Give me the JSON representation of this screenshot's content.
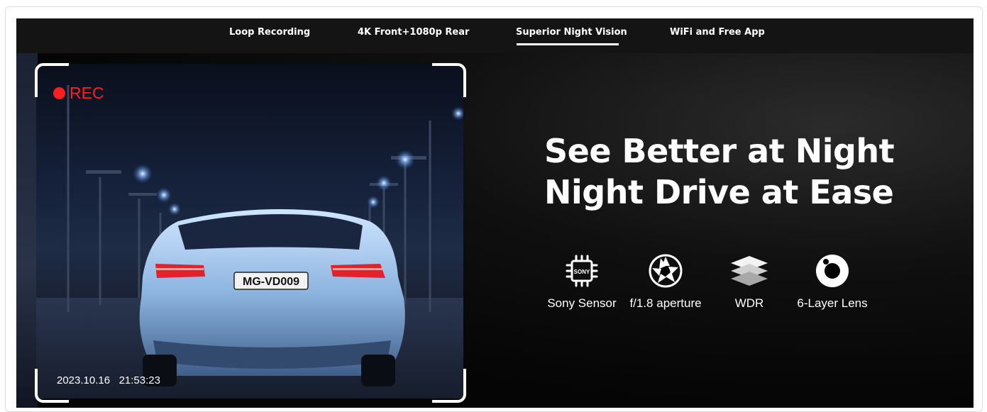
{
  "tabs": [
    {
      "label": "Loop Recording",
      "active": false
    },
    {
      "label": "4K Front+1080p Rear",
      "active": false
    },
    {
      "label": "Superior Night Vision",
      "active": true
    },
    {
      "label": "WiFi and Free App",
      "active": false
    }
  ],
  "camera": {
    "rec_label": "REC",
    "timestamp": "2023.10.16   21:53:23",
    "plate": "MG-VD009",
    "rec_color": "#ff1e1e"
  },
  "headline": {
    "line1": "See Better at Night",
    "line2": "Night Drive at Ease"
  },
  "features": [
    {
      "icon": "sony-chip-icon",
      "label": "Sony Sensor",
      "chip_text": "SONY"
    },
    {
      "icon": "aperture-icon",
      "label": "f/1.8 aperture"
    },
    {
      "icon": "layers-icon",
      "label": "WDR"
    },
    {
      "icon": "lens-ring-icon",
      "label": "6-Layer Lens"
    }
  ]
}
